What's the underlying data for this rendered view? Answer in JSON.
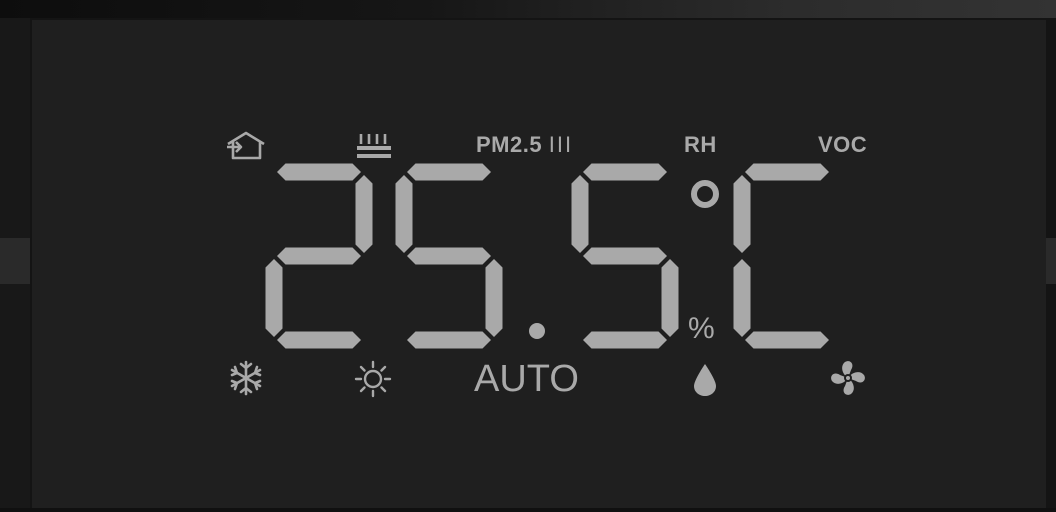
{
  "display": {
    "temperature": "25.5",
    "unit": "°C",
    "pct_symbol": "%",
    "lcd_color": "#a9a9a9",
    "background_color": "#1f1f1f"
  },
  "indicators_top": {
    "home_icon": "home-away-icon",
    "heating_icon": "floor-heating-icon",
    "pm_label": "PM2.5",
    "pm_bars": "III",
    "rh_label": "RH",
    "voc_label": "VOC"
  },
  "indicators_bottom": {
    "cool_icon": "snowflake-icon",
    "heat_icon": "sun-icon",
    "mode_label": "AUTO",
    "dry_icon": "water-drop-icon",
    "fan_icon": "fan-icon"
  }
}
